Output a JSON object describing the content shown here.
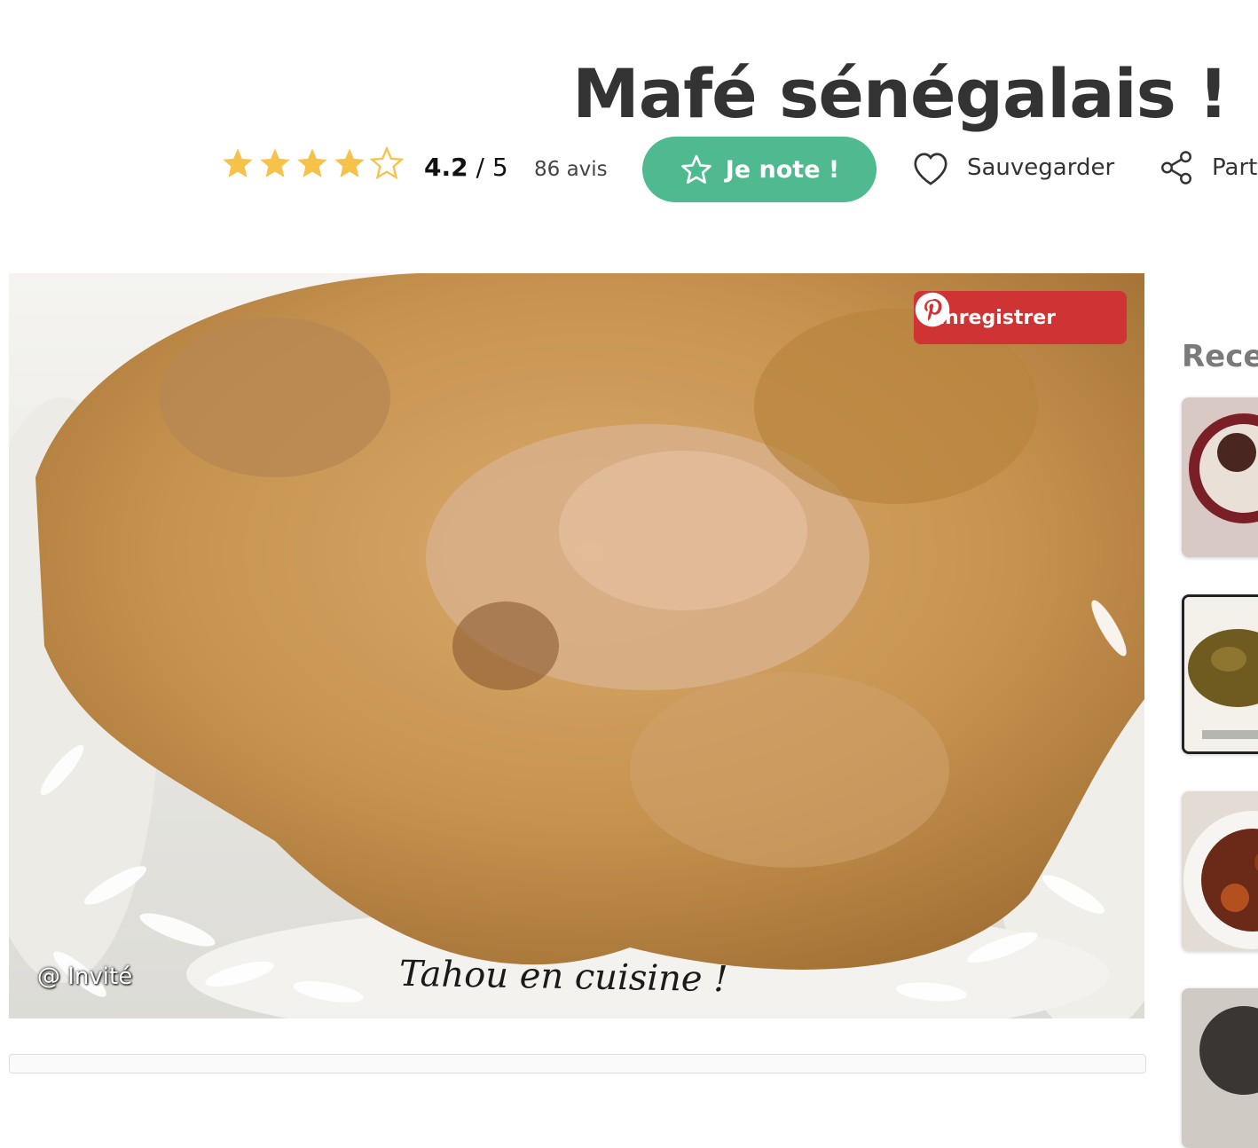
{
  "recipe": {
    "title": "Mafé sénégalais !"
  },
  "rating": {
    "value": 4.2,
    "score_value": "4.2",
    "score_suffix": " / 5",
    "max": 5,
    "reviews": "86 avis",
    "star_color": "#f6c24a"
  },
  "actions": {
    "note_label": "Je note !",
    "save_label": "Sauvegarder",
    "share_label": "Part"
  },
  "photo": {
    "pin_label": "Enregistrer",
    "credit": "@ Invité",
    "watermark": "Tahou en cuisine !"
  },
  "sidebar": {
    "title": "Rece"
  },
  "colors": {
    "accent_green": "#4fba8f",
    "pinterest_red": "#cf3333"
  }
}
